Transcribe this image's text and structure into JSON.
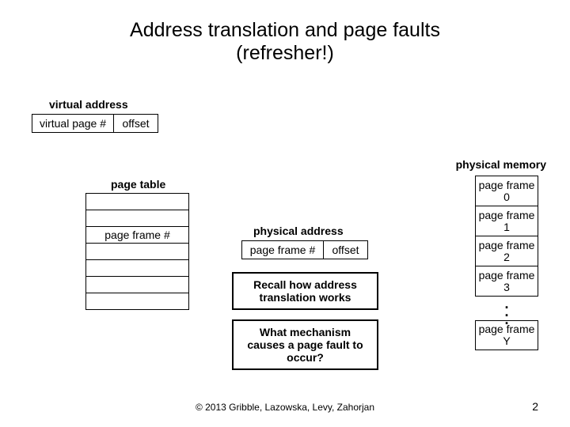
{
  "title_line1": "Address translation and page faults",
  "title_line2": "(refresher!)",
  "labels": {
    "virtual_address": "virtual address",
    "page_table": "page table",
    "physical_address": "physical address",
    "physical_memory": "physical memory"
  },
  "virtual_address": {
    "vpn": "virtual page #",
    "offset": "offset"
  },
  "page_table": {
    "rows": [
      "",
      "",
      "page frame #",
      "",
      "",
      "",
      ""
    ]
  },
  "physical_address": {
    "pfn": "page frame #",
    "offset": "offset"
  },
  "physical_memory": {
    "frames": [
      "page frame 0",
      "page frame 1",
      "page frame 2",
      "page frame 3"
    ],
    "last": "page frame Y"
  },
  "callouts": {
    "recall": "Recall how address translation works",
    "question": "What mechanism causes a page fault to occur?"
  },
  "footer": "© 2013 Gribble, Lazowska, Levy, Zahorjan",
  "page_number": "2"
}
